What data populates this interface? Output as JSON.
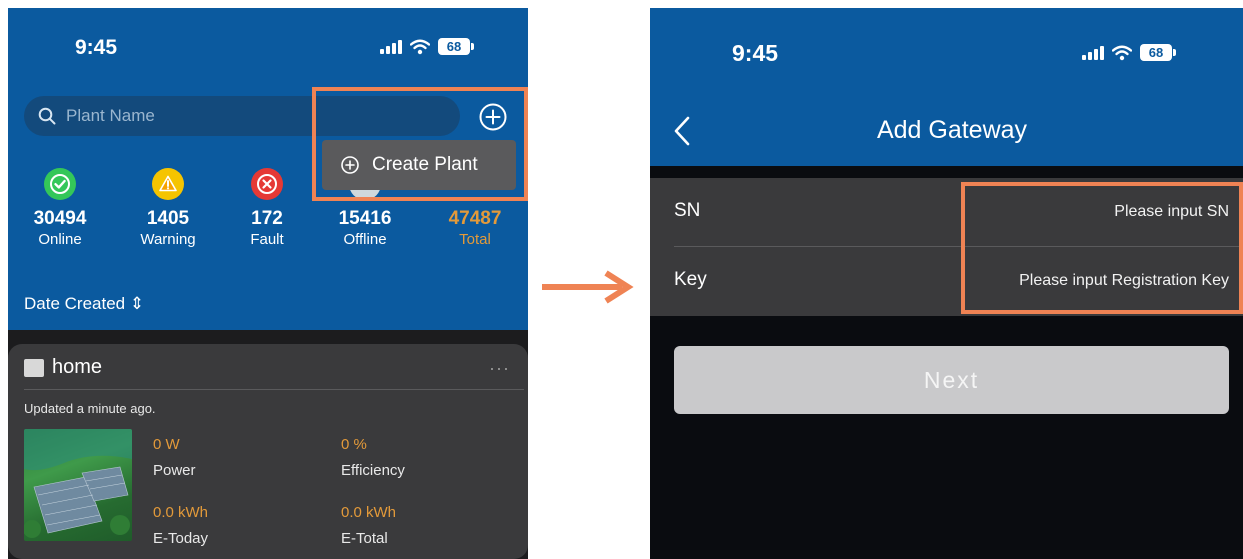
{
  "left_screen": {
    "status": {
      "time": "9:45",
      "battery": "68"
    },
    "search": {
      "placeholder": "Plant Name"
    },
    "menu": {
      "create_plant_label": "Create Plant"
    },
    "stats": [
      {
        "value": "30494",
        "label": "Online",
        "color": "#34c759"
      },
      {
        "value": "1405",
        "label": "Warning",
        "color": "#f5c400"
      },
      {
        "value": "172",
        "label": "Fault",
        "color": "#e53935"
      },
      {
        "value": "15416",
        "label": "Offline",
        "color": "#cfd8dc"
      },
      {
        "value": "47487",
        "label": "Total",
        "color": "#e39a3a"
      }
    ],
    "sort": {
      "label": "Date Created ⇕"
    },
    "plant_card": {
      "name": "home",
      "more": "···",
      "updated": "Updated a minute ago.",
      "power": {
        "value": "0 W",
        "label": "Power"
      },
      "efficiency": {
        "value": "0 %",
        "label": "Efficiency"
      },
      "e_today": {
        "value": "0.0 kWh",
        "label": "E-Today"
      },
      "e_total": {
        "value": "0.0 kWh",
        "label": "E-Total"
      }
    }
  },
  "right_screen": {
    "status": {
      "time": "9:45",
      "battery": "68"
    },
    "nav": {
      "title": "Add Gateway"
    },
    "form": {
      "sn_label": "SN",
      "sn_placeholder": "Please input SN",
      "key_label": "Key",
      "key_placeholder": "Please input Registration Key"
    },
    "next_label": "Next"
  },
  "colors": {
    "brand_blue": "#0b5a9f",
    "highlight": "#ef8354",
    "value_orange": "#e39a3a"
  }
}
